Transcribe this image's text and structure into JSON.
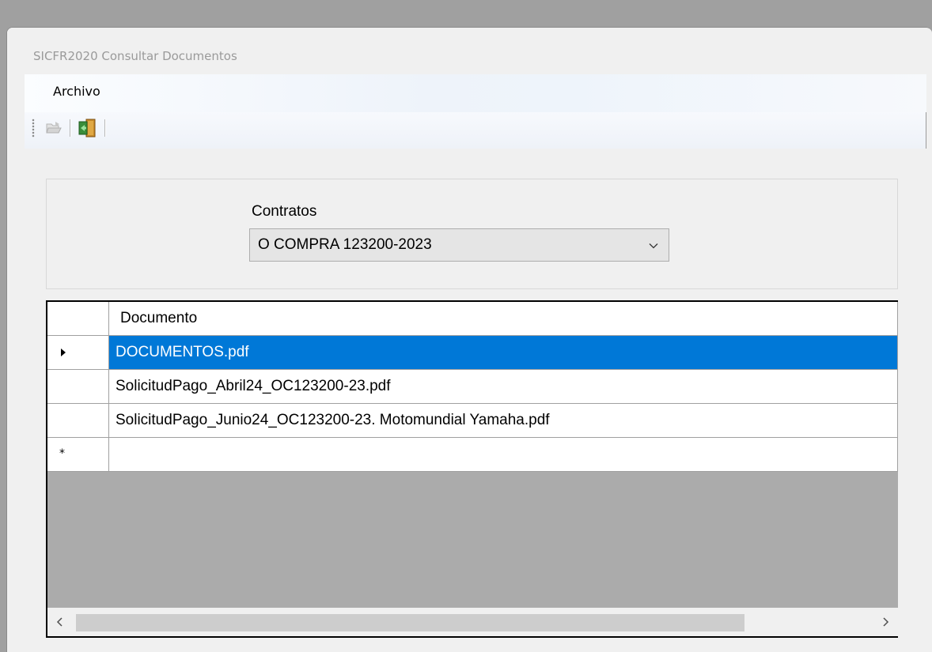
{
  "window": {
    "title": "SICFR2020 Consultar Documentos"
  },
  "menu": {
    "items": [
      {
        "label": "Archivo"
      }
    ]
  },
  "toolbar": {
    "buttons": [
      {
        "icon": "open-folder-icon",
        "enabled": false
      },
      {
        "icon": "exit-door-icon",
        "enabled": true
      }
    ]
  },
  "filter": {
    "label": "Contratos",
    "selected_value": "O COMPRA 123200-2023"
  },
  "grid": {
    "columns": [
      "Documento"
    ],
    "rows": [
      {
        "documento": "DOCUMENTOS.pdf",
        "selected": true
      },
      {
        "documento": "SolicitudPago_Abril24_OC123200-23.pdf",
        "selected": false
      },
      {
        "documento": "SolicitudPago_Junio24_OC123200-23. Motomundial Yamaha.pdf",
        "selected": false
      },
      {
        "documento": "",
        "selected": false
      }
    ],
    "new_row_marker": "*",
    "selection_color": "#0078d7"
  },
  "colors": {
    "accent": "#0078d7",
    "grid_background": "#ababab"
  }
}
